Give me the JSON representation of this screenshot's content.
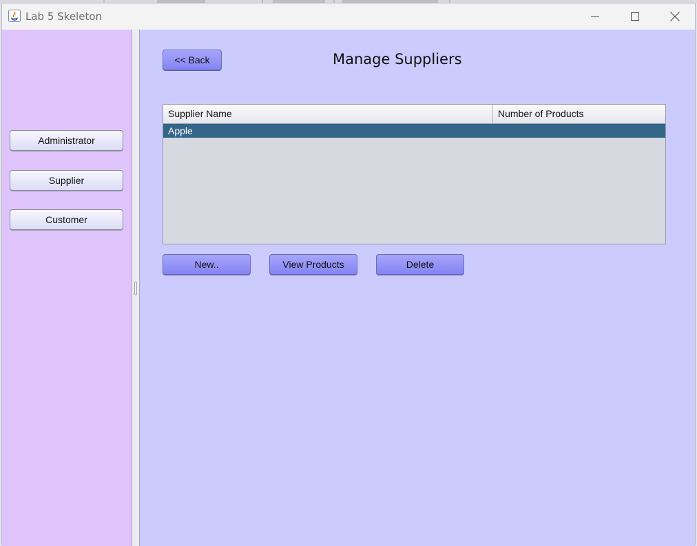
{
  "window": {
    "title": "Lab 5 Skeleton",
    "controls": {
      "minimize": "minimize",
      "maximize": "maximize",
      "close": "close"
    }
  },
  "sidebar": {
    "items": [
      {
        "label": "Administrator"
      },
      {
        "label": "Supplier"
      },
      {
        "label": "Customer"
      }
    ]
  },
  "main": {
    "back_label": "<< Back",
    "title": "Manage Suppliers",
    "table": {
      "columns": [
        "Supplier Name",
        "Number of Products"
      ],
      "rows": [
        {
          "name": "Apple",
          "count": "",
          "selected": true
        }
      ]
    },
    "actions": {
      "new_label": "New..",
      "view_label": "View Products",
      "delete_label": "Delete"
    }
  },
  "colors": {
    "sidebar_bg": "#dfc4fb",
    "main_bg": "#cbcbfd",
    "button_purple": "#8c8cf5",
    "selected_row": "#336688"
  }
}
